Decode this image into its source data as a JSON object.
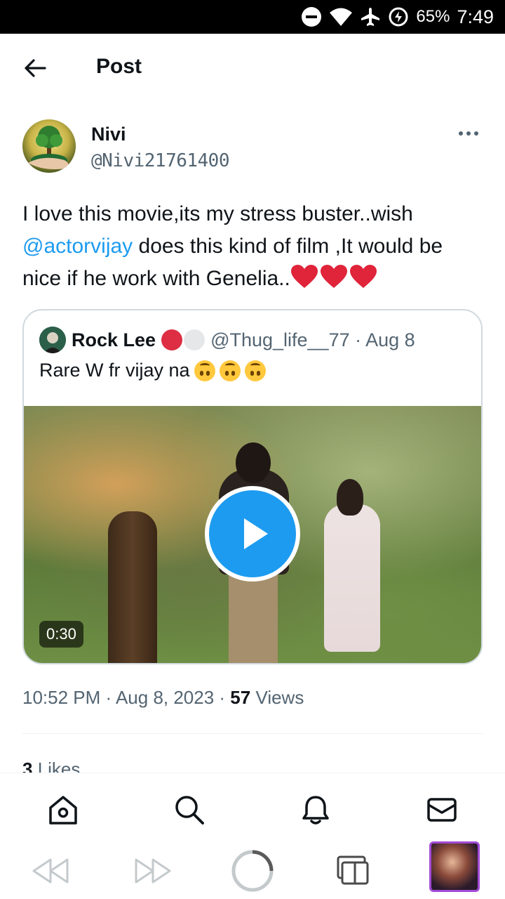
{
  "status_bar": {
    "battery_percent": "65%",
    "time": "7:49",
    "icons": [
      "dnd-icon",
      "wifi-icon",
      "airplane-icon",
      "battery-saver-icon"
    ]
  },
  "header": {
    "title": "Post"
  },
  "tweet": {
    "author_name": "Nivi",
    "author_handle": "@Nivi21761400",
    "text_line_1": "I love this movie,its my stress buster..wish ",
    "mention": "@actorvijay",
    "text_rest": " does this kind of film ,It would be nice if he work with Genelia..",
    "timestamp": "10:52 PM · Aug 8, 2023 · ",
    "views_count": "57",
    "views_label": " Views",
    "likes_count": "3",
    "likes_label": " Likes"
  },
  "quote": {
    "author_name": "Rock Lee",
    "author_handle": "@Thug_life__77 · Aug 8",
    "text": "Rare W fr vijay na",
    "video_duration": "0:30"
  },
  "colors": {
    "accent": "#1d9bf0",
    "secondary_text": "#536471",
    "heart": "#e0243a"
  },
  "bottom_nav": [
    "home-icon",
    "search-icon",
    "notifications-icon",
    "messages-icon"
  ],
  "system_bar": [
    "back-icon",
    "forward-icon",
    "reload-icon",
    "tabs-icon",
    "profile-thumbnail"
  ]
}
